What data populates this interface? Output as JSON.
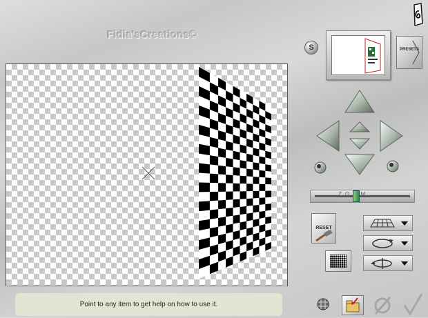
{
  "brand": {
    "text": "Fidia'sCreations©"
  },
  "status": {
    "help_text": "Point to any item to get help on how to use it."
  },
  "toolbar": {
    "s_label": "S",
    "presets_label": "PRESETS",
    "reset_label": "RESET",
    "zoom_label": "ZOOM",
    "zoom_value": 0.42
  },
  "colors": {
    "checker_light": "#c8c8c8",
    "tile_dark": "#000000",
    "zoom_knob": "#2f8a2f",
    "status_bg": "#e4e4d2"
  },
  "icons": [
    "logo-icon",
    "arrow-up-icon",
    "arrow-down-icon",
    "arrow-left-icon",
    "arrow-right-icon",
    "center-up-icon",
    "center-down-icon",
    "rotate-left-icon",
    "rotate-right-icon",
    "grid-plane-icon",
    "rotate-circle-icon",
    "spin-axis-icon",
    "chevron-down-icon",
    "grid-icon",
    "open-folder-icon",
    "cancel-icon",
    "ok-check-icon"
  ]
}
